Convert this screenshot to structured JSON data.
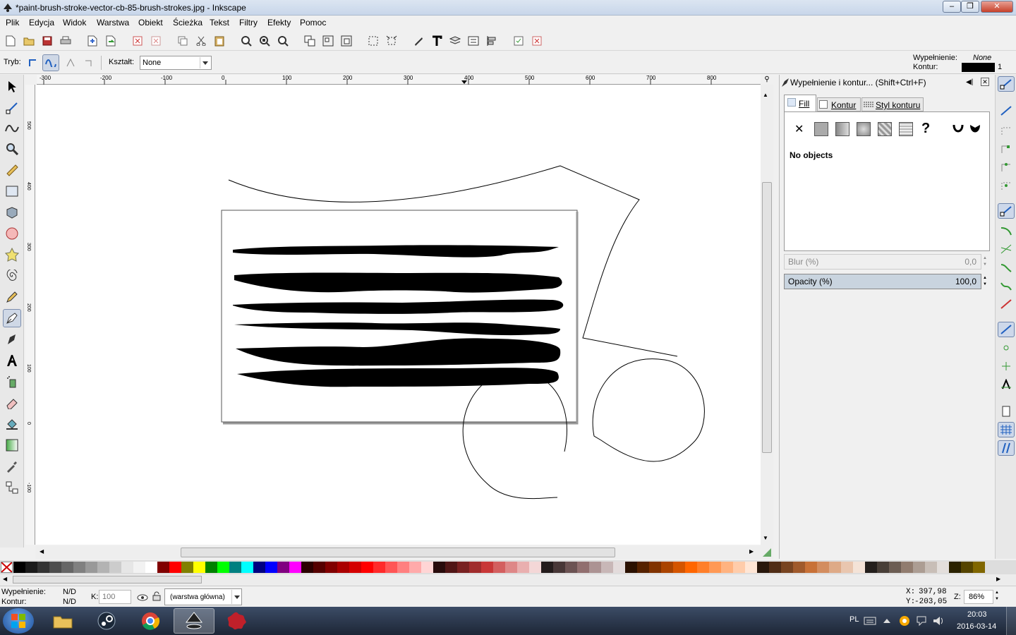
{
  "window": {
    "title": "*paint-brush-stroke-vector-cb-85-brush-strokes.jpg - Inkscape"
  },
  "menu": [
    "Plik",
    "Edycja",
    "Widok",
    "Warstwa",
    "Obiekt",
    "Ścieżka",
    "Tekst",
    "Filtry",
    "Efekty",
    "Pomoc"
  ],
  "toolbar_controls": {
    "mode_label": "Tryb:",
    "shape_label": "Kształt:",
    "shape_value": "None"
  },
  "style_indicator": {
    "fill_label": "Wypełnienie:",
    "fill_value": "None",
    "stroke_label": "Kontur:",
    "stroke_width": "1"
  },
  "ruler_h": [
    "-300",
    "-200",
    "-100",
    "0",
    "100",
    "200",
    "300",
    "400",
    "500",
    "600",
    "700",
    "800"
  ],
  "ruler_v": [
    "500",
    "400",
    "300",
    "200",
    "100",
    "0",
    "-100"
  ],
  "panel": {
    "title": "Wypełnienie i kontur... (Shift+Ctrl+F)",
    "tabs": [
      "Fill",
      "Kontur",
      "Styl konturu"
    ],
    "no_objects": "No objects",
    "blur_label": "Blur (%)",
    "blur_value": "0,0",
    "opacity_label": "Opacity (%)",
    "opacity_value": "100,0"
  },
  "palette_colors": [
    "#000000",
    "#1a1a1a",
    "#333333",
    "#4d4d4d",
    "#666666",
    "#808080",
    "#999999",
    "#b3b3b3",
    "#cccccc",
    "#e6e6e6",
    "#f2f2f2",
    "#ffffff",
    "#800000",
    "#ff0000",
    "#808000",
    "#ffff00",
    "#008000",
    "#00ff00",
    "#008080",
    "#00ffff",
    "#000080",
    "#0000ff",
    "#800080",
    "#ff00ff",
    "#2b0000",
    "#550000",
    "#800000",
    "#aa0000",
    "#d40000",
    "#ff0000",
    "#ff2a2a",
    "#ff5555",
    "#ff8080",
    "#ffaaaa",
    "#ffd5d5",
    "#280b0b",
    "#501616",
    "#782121",
    "#a02c2c",
    "#c83737",
    "#d35f5f",
    "#de8787",
    "#e9afaf",
    "#f4d7d7",
    "#241c1c",
    "#483737",
    "#6c5353",
    "#916f6f",
    "#ac9393",
    "#c8b7b7",
    "#e3dbdb",
    "#2b1100",
    "#552200",
    "#803300",
    "#aa4400",
    "#d45500",
    "#ff6600",
    "#ff7f2a",
    "#ff9955",
    "#ffb380",
    "#ffccaa",
    "#ffe6d5",
    "#28170b",
    "#502d16",
    "#784421",
    "#a05a2c",
    "#c87137",
    "#d38d5f",
    "#deaa87",
    "#e9c6af",
    "#f4e3d7",
    "#241f1c",
    "#483e37",
    "#6c5d53",
    "#917c6f",
    "#ac9d93",
    "#c8beb7",
    "#e3dedb",
    "#2b2200",
    "#554400",
    "#806600"
  ],
  "status": {
    "fill_label": "Wypełnienie:",
    "fill_value": "N/D",
    "stroke_label": "Kontur:",
    "stroke_value": "N/D",
    "opacity_label": "K:",
    "opacity_value": "100",
    "layer": "(warstwa główna)",
    "x_label": "X:",
    "x_value": "397,98",
    "y_label": "Y:",
    "y_value": "-203,05",
    "zoom_label": "Z:",
    "zoom_value": "86%"
  },
  "taskbar": {
    "lang": "PL",
    "time": "20:03",
    "date": "2016-03-14"
  }
}
